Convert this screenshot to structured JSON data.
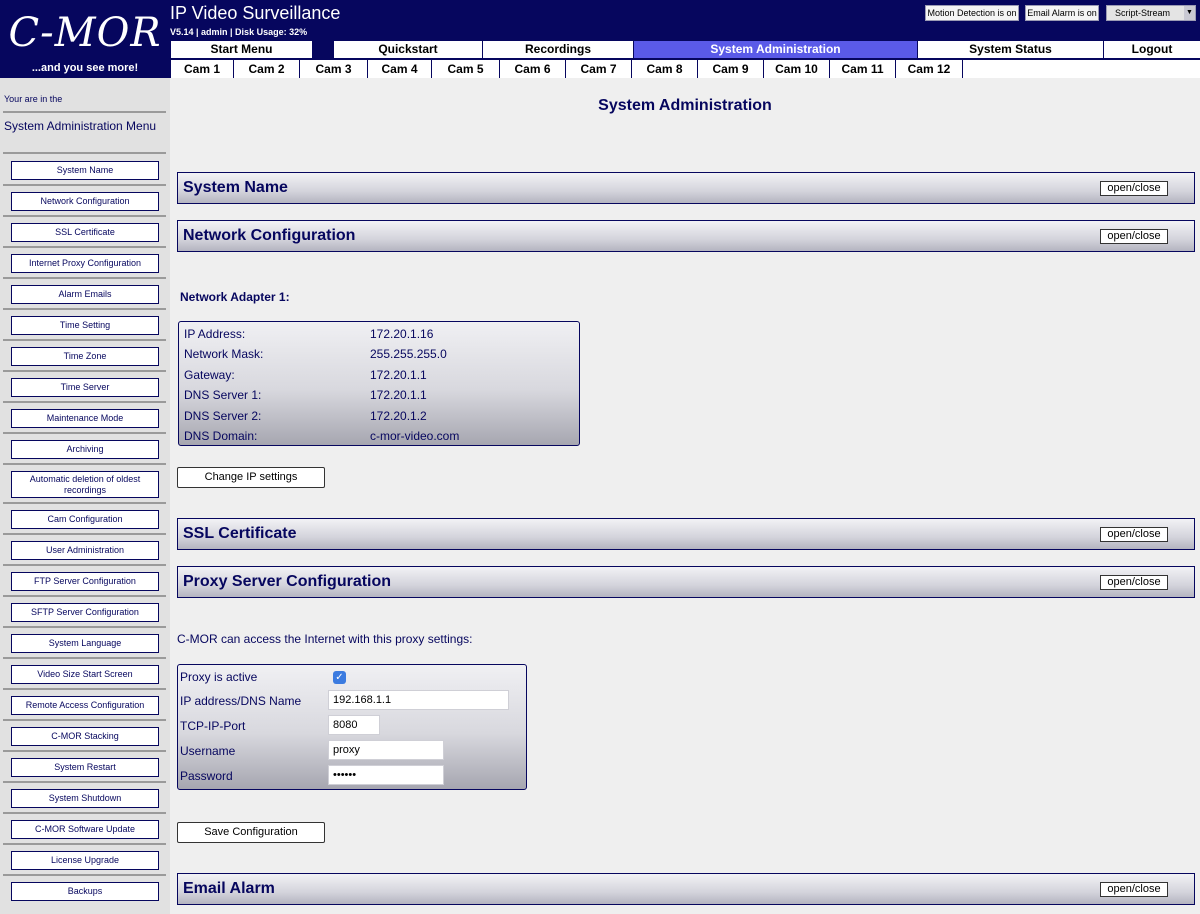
{
  "header": {
    "logo": "C-MOR",
    "tagline": "...and you see more!",
    "title": "IP Video Surveillance",
    "subtitle": "V5.14 | admin | Disk Usage: 32%",
    "motion_detection": "Motion Detection is on",
    "email_alarm": "Email Alarm is on",
    "script_stream": "Script-Stream"
  },
  "nav": [
    {
      "label": "Start Menu"
    },
    {
      "label": "Quickstart"
    },
    {
      "label": "Recordings"
    },
    {
      "label": "System Administration"
    },
    {
      "label": "System Status"
    },
    {
      "label": "Logout"
    }
  ],
  "cams": [
    "Cam 1",
    "Cam 2",
    "Cam 3",
    "Cam 4",
    "Cam 5",
    "Cam 6",
    "Cam 7",
    "Cam 8",
    "Cam 9",
    "Cam 10",
    "Cam 11",
    "Cam 12"
  ],
  "sidebar": {
    "intro": "Your are in the",
    "title": "System Administration Menu",
    "items": [
      "System Name",
      "Network Configuration",
      "SSL Certificate",
      "Internet Proxy Configuration",
      "Alarm Emails",
      "Time Setting",
      "Time Zone",
      "Time Server",
      "Maintenance Mode",
      "Archiving",
      "Automatic deletion of oldest recordings",
      "Cam Configuration",
      "User Administration",
      "FTP Server Configuration",
      "SFTP Server Configuration",
      "System Language",
      "Video Size Start Screen",
      "Remote Access Configuration",
      "C-MOR Stacking",
      "System Restart",
      "System Shutdown",
      "C-MOR Software Update",
      "License Upgrade",
      "Backups"
    ]
  },
  "main": {
    "title": "System Administration",
    "open_close": "open/close",
    "sections": {
      "system_name": "System Name",
      "network": "Network Configuration",
      "ssl": "SSL Certificate",
      "proxy": "Proxy Server Configuration",
      "email": "Email Alarm"
    },
    "network": {
      "adapter_title": "Network Adapter 1:",
      "rows": [
        {
          "label": "IP Address:",
          "value": "172.20.1.16"
        },
        {
          "label": "Network Mask:",
          "value": "255.255.255.0"
        },
        {
          "label": "Gateway:",
          "value": "172.20.1.1"
        },
        {
          "label": "DNS Server 1:",
          "value": "172.20.1.1"
        },
        {
          "label": "DNS Server 2:",
          "value": "172.20.1.2"
        },
        {
          "label": "DNS Domain:",
          "value": "c-mor-video.com"
        }
      ],
      "change_button": "Change IP settings"
    },
    "proxy": {
      "intro": "C-MOR can access the Internet with this proxy settings:",
      "active_label": "Proxy is active",
      "active_checked": true,
      "address_label": "IP address/DNS Name",
      "address_value": "192.168.1.1",
      "port_label": "TCP-IP-Port",
      "port_value": "8080",
      "username_label": "Username",
      "username_value": "proxy",
      "password_label": "Password",
      "password_value": "secret",
      "save_button": "Save Configuration"
    }
  }
}
